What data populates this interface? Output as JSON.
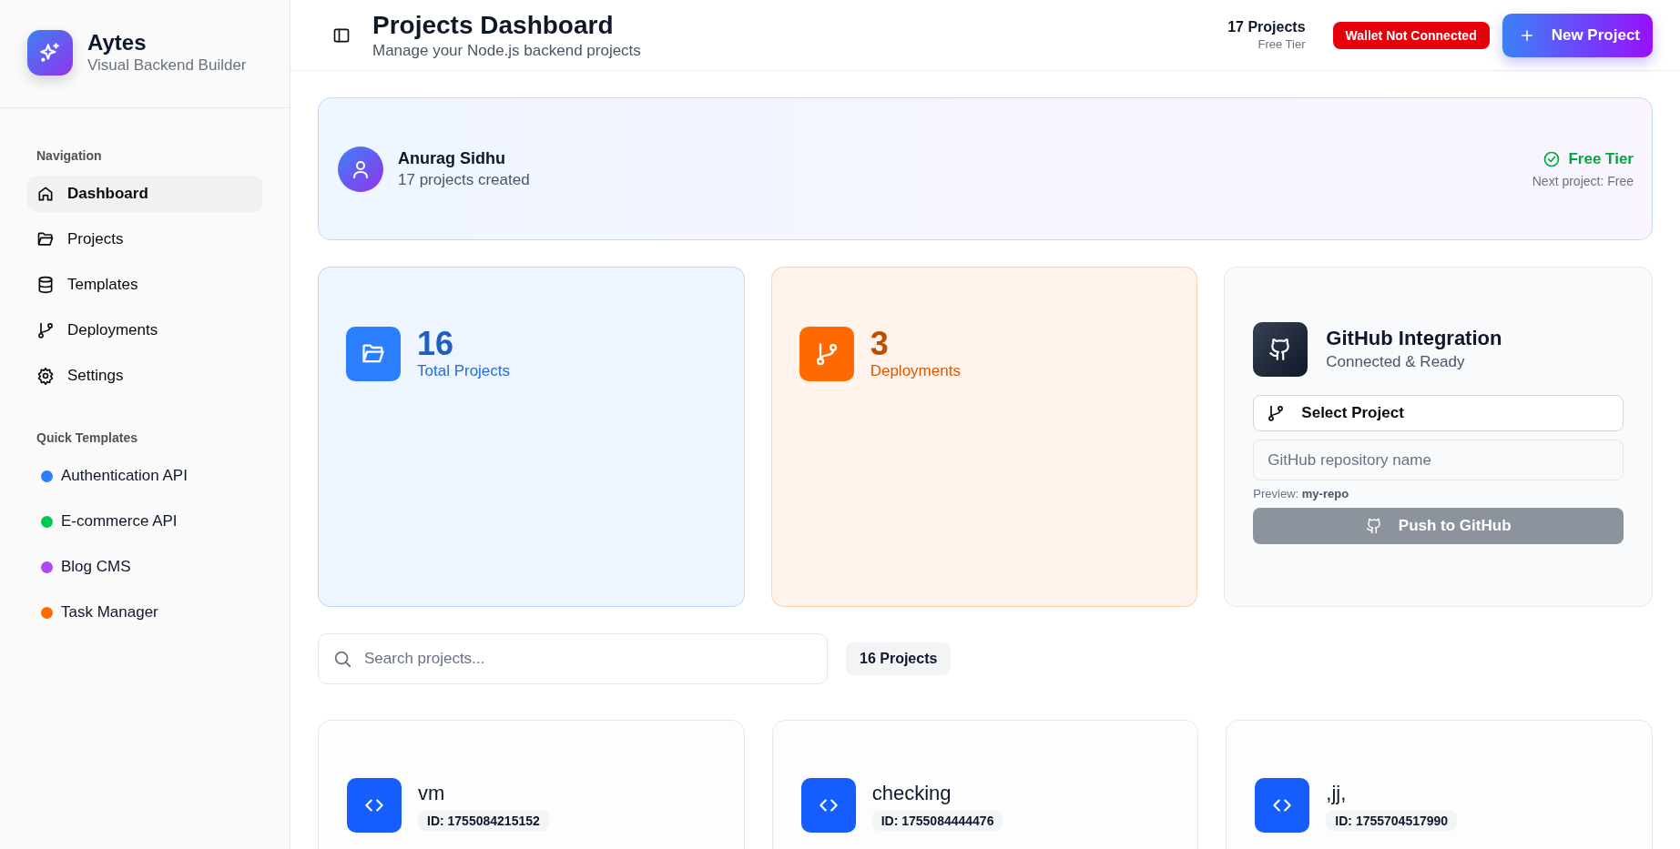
{
  "brand": {
    "name": "Aytes",
    "tagline": "Visual Backend Builder"
  },
  "navigation": {
    "heading": "Navigation",
    "items": [
      {
        "label": "Dashboard",
        "selected": true
      },
      {
        "label": "Projects",
        "selected": false
      },
      {
        "label": "Templates",
        "selected": false
      },
      {
        "label": "Deployments",
        "selected": false
      },
      {
        "label": "Settings",
        "selected": false
      }
    ]
  },
  "quick_templates": {
    "heading": "Quick Templates",
    "items": [
      {
        "label": "Authentication API",
        "color": "#2b7fff"
      },
      {
        "label": "E-commerce API",
        "color": "#00c950"
      },
      {
        "label": "Blog CMS",
        "color": "#ad46ff"
      },
      {
        "label": "Task Manager",
        "color": "#ff6900"
      }
    ]
  },
  "header": {
    "title": "Projects Dashboard",
    "subtitle": "Manage your Node.js backend projects",
    "project_count": "17 Projects",
    "tier": "Free Tier",
    "wallet_status": "Wallet Not Connected",
    "new_project_button": "New Project"
  },
  "user": {
    "name": "Anurag Sidhu",
    "projects_created": "17 projects created",
    "tier": "Free Tier",
    "next_project": "Next project: Free"
  },
  "stats": [
    {
      "value": "16",
      "label": "Total Projects",
      "color": "#2b7fff"
    },
    {
      "value": "3",
      "label": "Deployments",
      "color": "#ff6900"
    }
  ],
  "github": {
    "title": "GitHub Integration",
    "status": "Connected & Ready",
    "select_button": "Select Project",
    "repo_field": {
      "placeholder": "GitHub repository name"
    },
    "preview_label": "Preview:",
    "preview_value": "my-repo",
    "push_button": {
      "label": "Push to GitHub",
      "disabled": true
    }
  },
  "search": {
    "placeholder": "Search projects..."
  },
  "projects_count": "16 Projects",
  "projects": [
    {
      "name": "vm",
      "id": "ID: 1755084215152"
    },
    {
      "name": "checking",
      "id": "ID: 1755084444476"
    },
    {
      "name": ",jj,",
      "id": "ID: 1755704517990"
    }
  ]
}
